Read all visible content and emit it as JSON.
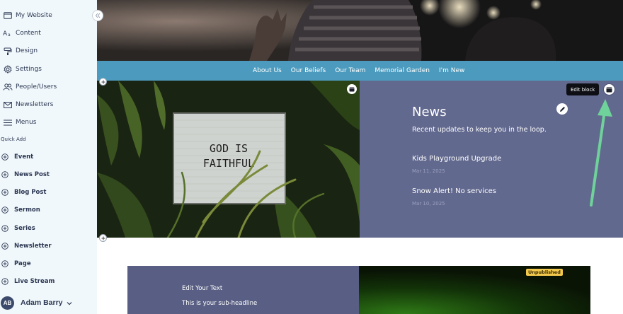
{
  "sidebar": {
    "nav": [
      {
        "label": "My Website",
        "icon": "browser-icon"
      },
      {
        "label": "Content",
        "icon": "text-icon"
      },
      {
        "label": "Design",
        "icon": "paint-roller-icon"
      },
      {
        "label": "Settings",
        "icon": "gear-icon"
      },
      {
        "label": "People/Users",
        "icon": "users-icon"
      },
      {
        "label": "Newsletters",
        "icon": "mail-icon"
      },
      {
        "label": "Menus",
        "icon": "menu-icon"
      }
    ],
    "quick_add_label": "Quick Add",
    "quick_add": [
      {
        "label": "Event"
      },
      {
        "label": "News Post"
      },
      {
        "label": "Blog Post"
      },
      {
        "label": "Sermon"
      },
      {
        "label": "Series"
      },
      {
        "label": "Newsletter"
      },
      {
        "label": "Page"
      },
      {
        "label": "Live Stream"
      }
    ],
    "user": {
      "initials": "AB",
      "name": "Adam Barry"
    }
  },
  "site_nav": [
    "About Us",
    "Our Beliefs",
    "Our Team",
    "Memorial Garden",
    "I'm New"
  ],
  "photo_sign": {
    "line1": "GOD IS",
    "line2": "FAITHFUL"
  },
  "news": {
    "title": "News",
    "subtitle": "Recent updates to keep you in the loop.",
    "posts": [
      {
        "title": "Kids Playground Upgrade",
        "date": "Mar 11, 2025"
      },
      {
        "title": "Snow Alert! No services",
        "date": "Mar 10, 2025"
      }
    ],
    "edit_tooltip": "Edit block"
  },
  "lower_block": {
    "title": "Edit Your Text",
    "subtitle": "This is your sub-headline",
    "status_badge": "Unpublished"
  },
  "colors": {
    "sidebar_bg": "#f0f8fb",
    "nav_bar": "#4c9bbe",
    "news_bg": "#62698f",
    "arrow": "#6fd29a",
    "badge": "#f2c94c"
  }
}
